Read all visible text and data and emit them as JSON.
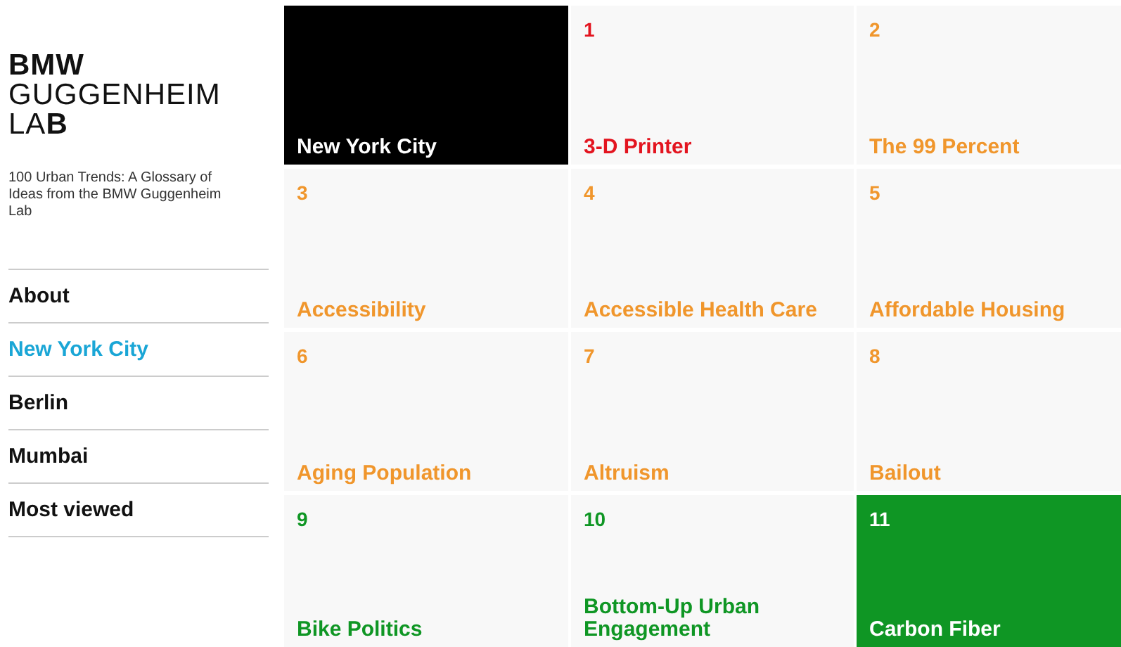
{
  "logo": {
    "lines": [
      "BMW",
      "GUGGENHEIM",
      "LA**B**"
    ]
  },
  "tagline": "100 Urban Trends: A Glossary of Ideas from the BMW Guggenheim Lab",
  "nav": [
    {
      "label": "About",
      "selected": false
    },
    {
      "label": "New York City",
      "selected": true
    },
    {
      "label": "Berlin",
      "selected": false
    },
    {
      "label": "Mumbai",
      "selected": false
    },
    {
      "label": "Most viewed",
      "selected": false
    }
  ],
  "city_tile": {
    "title": "New York City"
  },
  "tiles": [
    {
      "kind": "trend",
      "number": "1",
      "title": "3-D Printer",
      "highlighted": false,
      "color": "#e3141f"
    },
    {
      "kind": "trend",
      "number": "2",
      "title": "The 99 Percent",
      "highlighted": false,
      "color": "#f0962c"
    },
    {
      "kind": "trend",
      "number": "3",
      "title": "Accessibility",
      "highlighted": false,
      "color": "#f0962c"
    },
    {
      "kind": "trend",
      "number": "4",
      "title": "Accessible Health Care",
      "highlighted": false,
      "color": "#f0962c"
    },
    {
      "kind": "trend",
      "number": "5",
      "title": "Affordable Housing",
      "highlighted": false,
      "color": "#f0962c"
    },
    {
      "kind": "trend",
      "number": "6",
      "title": "Aging Population",
      "highlighted": false,
      "color": "#f0962c"
    },
    {
      "kind": "trend",
      "number": "7",
      "title": "Altruism",
      "highlighted": false,
      "color": "#f0962c"
    },
    {
      "kind": "trend",
      "number": "8",
      "title": "Bailout",
      "highlighted": false,
      "color": "#f0962c"
    },
    {
      "kind": "trend",
      "number": "9",
      "title": "Bike Politics",
      "highlighted": false,
      "color": "#0f9624"
    },
    {
      "kind": "trend",
      "number": "10",
      "title": "Bottom-Up Urban Engagement",
      "highlighted": false,
      "color": "#0f9624"
    },
    {
      "kind": "trend",
      "number": "11",
      "title": "Carbon Fiber",
      "highlighted": true,
      "color": "#0f9624"
    }
  ]
}
